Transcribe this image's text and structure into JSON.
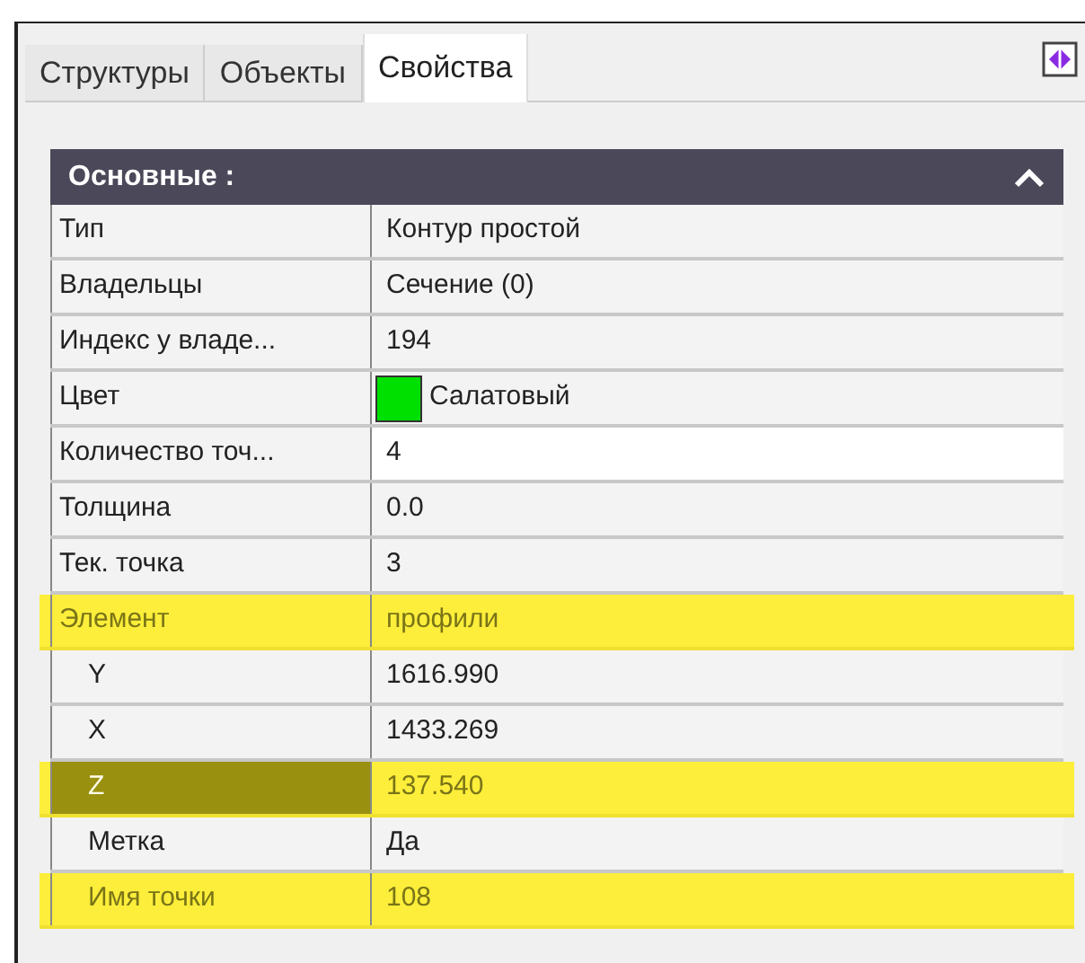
{
  "tabs": [
    {
      "label": "Структуры",
      "selected": false
    },
    {
      "label": "Объекты",
      "selected": false
    },
    {
      "label": "Свойства",
      "selected": true
    }
  ],
  "section": {
    "title": "Основные :",
    "expanded": true
  },
  "rows": [
    {
      "name": "Тип",
      "value": "Контур простой",
      "editing": false,
      "selected": false,
      "highlighted": false
    },
    {
      "name": "Владельцы",
      "value": "Сечение (0)",
      "editing": false,
      "selected": false,
      "highlighted": false
    },
    {
      "name": "Индекс у владе...",
      "value": "194",
      "editing": false,
      "selected": false,
      "highlighted": false
    },
    {
      "name": "Цвет",
      "value": "Салатовый",
      "color": "#00e000",
      "editing": false,
      "selected": false,
      "highlighted": false
    },
    {
      "name": "Количество точ...",
      "value": "4",
      "editing": true,
      "selected": false,
      "highlighted": false
    },
    {
      "name": "Толщина",
      "value": "0.0",
      "editing": false,
      "selected": false,
      "highlighted": false
    },
    {
      "name": "Тек. точка",
      "value": "3",
      "editing": false,
      "selected": false,
      "highlighted": false
    },
    {
      "name": "Элемент",
      "value": "профили",
      "editing": false,
      "selected": false,
      "highlighted": true,
      "children": [
        {
          "name": "Y",
          "value": "1616.990",
          "editing": false,
          "selected": false,
          "highlighted": false
        },
        {
          "name": "X",
          "value": "1433.269",
          "editing": false,
          "selected": false,
          "highlighted": false
        },
        {
          "name": "Z",
          "value": "137.540",
          "editing": false,
          "selected": true,
          "highlighted": true
        },
        {
          "name": "Метка",
          "value": "Да",
          "editing": false,
          "selected": false,
          "highlighted": false
        },
        {
          "name": "Имя точки",
          "value": "108",
          "editing": false,
          "selected": false,
          "highlighted": true
        }
      ]
    }
  ]
}
